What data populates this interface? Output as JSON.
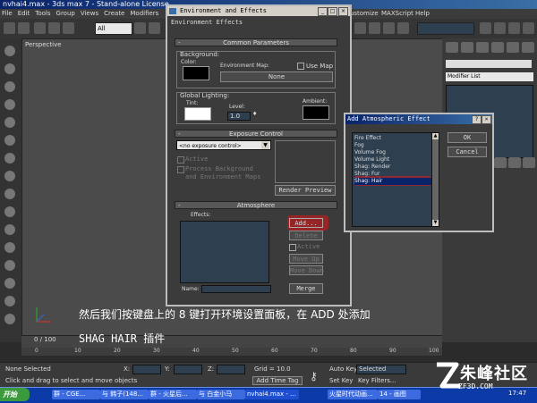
{
  "app": {
    "title": "nvhai4.max - 3ds max 7  - Stand-alone License",
    "menu": [
      "File",
      "Edit",
      "Tools",
      "Group",
      "Views",
      "Create",
      "Modifiers",
      "Customize",
      "MAXScript",
      "Help"
    ],
    "selection_filter": "All",
    "viewport_label": "Perspective",
    "modifier_list": "Modifier List"
  },
  "env_dialog": {
    "title": "Environment and Effects",
    "tab": "Environment  Effects",
    "common": {
      "header": "Common Parameters",
      "background_label": "Background:",
      "color_label": "Color:",
      "env_map_label": "Environment Map:",
      "use_map_label": "Use Map",
      "env_map_button": "None",
      "global_lighting_label": "Global Lighting:",
      "tint_label": "Tint:",
      "level_label": "Level:",
      "level_value": "1.0",
      "ambient_label": "Ambient:"
    },
    "exposure": {
      "header": "Exposure Control",
      "select": "<no exposure control>",
      "active_label": "Active",
      "process_label_1": "Process Background",
      "process_label_2": "and Environment Maps",
      "render_preview": "Render Preview"
    },
    "atmosphere": {
      "header": "Atmosphere",
      "effects_label": "Effects:",
      "add": "Add...",
      "delete": "Delete",
      "active": "Active",
      "move_up": "Move Up",
      "move_down": "Move Down",
      "name_label": "Name:",
      "merge": "Merge"
    }
  },
  "atm_dialog": {
    "title": "Add Atmospheric Effect",
    "items": [
      "Fire Effect",
      "Fog",
      "Volume Fog",
      "Volume Light",
      "Shag: Render",
      "Shag: Fur",
      "Shag: Hair"
    ],
    "selected_index": 6,
    "ok": "OK",
    "cancel": "Cancel"
  },
  "timeline": {
    "position": "0 / 100",
    "ruler": [
      "0",
      "10",
      "20",
      "30",
      "40",
      "50",
      "60",
      "70",
      "80",
      "90",
      "100"
    ]
  },
  "status": {
    "selection": "None Selected",
    "prompt": "Click and drag to select and move objects",
    "x_label": "X:",
    "y_label": "Y:",
    "z_label": "Z:",
    "grid": "Grid = 10.0",
    "add_time_tag": "Add Time Tag",
    "auto_key": "Auto Key",
    "auto_key_value": "Selected",
    "set_key": "Set Key",
    "key_filters": "Key Filters..."
  },
  "taskbar": {
    "start": "开始",
    "tasks": [
      "群 - CGE...",
      "与 韩子(148...",
      "群 - 火星后...",
      "与 白金小马",
      "nvhai4.max - ...",
      "火星时代动画...",
      "14 - 画图"
    ],
    "clock": "17:47"
  },
  "subtitle": {
    "line1": "然后我们按键盘上的 8 键打开环境设置面板，在 ADD 处添加",
    "line2": "SHAG HAIR 插件"
  },
  "watermark": {
    "text": "朱峰社区",
    "url": "ZF3D.COM"
  },
  "colors": {
    "title_blue": "#0a246a",
    "highlight_red": "#e61414",
    "panel_bg": "#3b3b3b"
  }
}
